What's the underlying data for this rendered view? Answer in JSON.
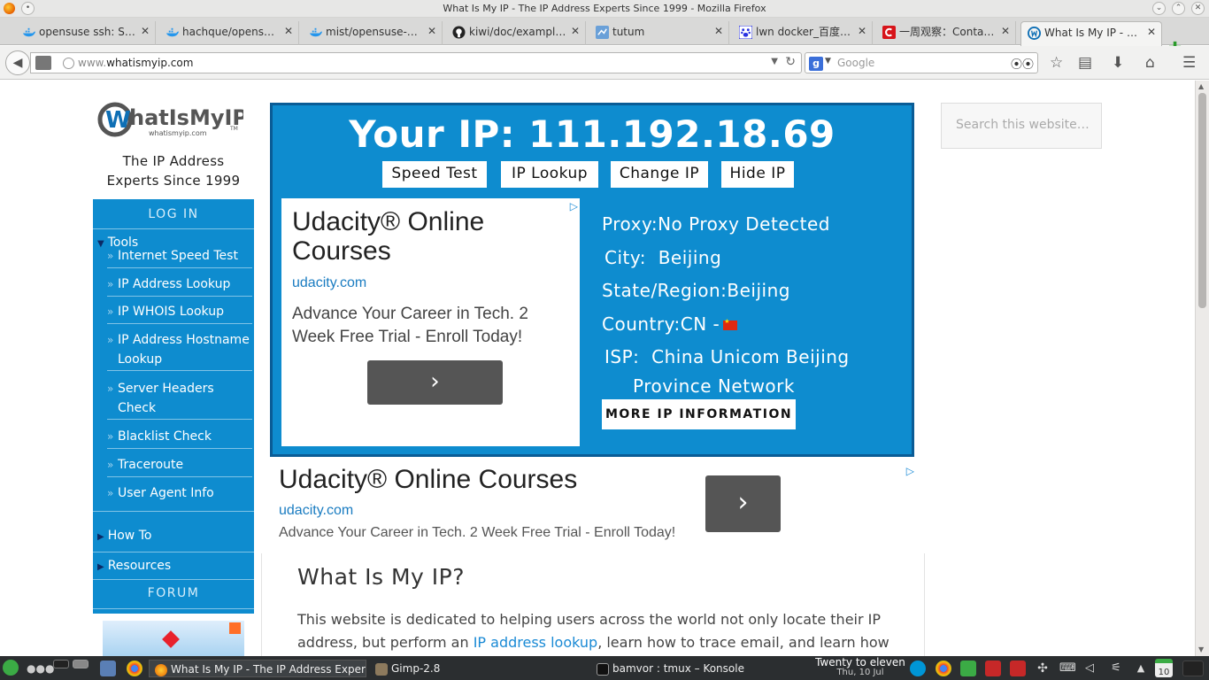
{
  "window": {
    "title": "What Is My IP - The IP Address Experts Since 1999 - Mozilla Firefox"
  },
  "tabs": [
    {
      "label": "opensuse ssh: Se…",
      "icon": "docker-whale-icon"
    },
    {
      "label": "hachque/opensu…",
      "icon": "docker-whale-icon"
    },
    {
      "label": "mist/opensuse-1…",
      "icon": "docker-whale-icon"
    },
    {
      "label": "kiwi/doc/exampl…",
      "icon": "github-icon"
    },
    {
      "label": "tutum",
      "icon": "tutum-icon"
    },
    {
      "label": "lwn docker_百度…",
      "icon": "baidu-paw-icon"
    },
    {
      "label": "一周观察：Conta…",
      "icon": "c-logo-icon"
    },
    {
      "label": "What Is My IP - T…",
      "icon": "whatismyip-icon",
      "active": true
    }
  ],
  "navbar": {
    "url_prefix": "www.",
    "url_domain": "whatismyip.com",
    "search_engine": "g",
    "search_placeholder": "Google"
  },
  "site": {
    "logo_text": "hatIsMyIP",
    "logo_w": "W",
    "logo_domain": "whatismyip.com",
    "logo_tm": "TM",
    "tagline": "The IP Address Experts Since 1999",
    "search_placeholder": "Search this website…"
  },
  "sidebar": {
    "login": "LOG IN",
    "tools_label": "Tools",
    "tools": [
      "Internet Speed Test",
      "IP Address Lookup",
      "IP WHOIS Lookup",
      "IP Address Hostname Lookup",
      "Server Headers Check",
      "Blacklist Check",
      "Traceroute",
      "User Agent Info"
    ],
    "howto": "How To",
    "resources": "Resources",
    "forum": "FORUM",
    "tri_down": "▼",
    "tri_right": "▶",
    "bullet": "»"
  },
  "ipbox": {
    "title": "Your IP: 111.192.18.69",
    "buttons": [
      "Speed Test",
      "IP Lookup",
      "Change IP",
      "Hide IP"
    ],
    "proxy_label": "Proxy:",
    "proxy_value": "No Proxy Detected",
    "city_label": "City:",
    "city_value": "Beijing",
    "state_label": "State/Region:",
    "state_value": "Beijing",
    "country_label": "Country:",
    "country_value": "CN -",
    "isp_label": "ISP:",
    "isp_line1": "China Unicom Beijing",
    "isp_line2": "Province Network",
    "more_button": "MORE IP INFORMATION"
  },
  "ad": {
    "headline": "Udacity® Online Courses",
    "url": "udacity.com",
    "text": "Advance Your Career in Tech. 2 Week Free Trial - Enroll Today!",
    "cta": "›",
    "adchoices": "▷"
  },
  "article": {
    "heading": "What Is My IP?",
    "text_before": "This website is dedicated to helping users across the world not only locate their IP address, but perform an ",
    "link": "IP address lookup",
    "text_after": ", learn how to trace email, and learn how"
  },
  "taskbar": {
    "active_window": "What Is My IP - The IP Address Experts",
    "gimp": "Gimp-2.8",
    "konsole": "bamvor : tmux – Konsole",
    "clock_title": "Twenty to eleven",
    "clock_date": "Thu, 10 Jul",
    "calendar_day": "10"
  },
  "colors": {
    "brand_blue": "#0e8ccf",
    "brand_border": "#0a5c96",
    "link": "#1a8ad5"
  }
}
